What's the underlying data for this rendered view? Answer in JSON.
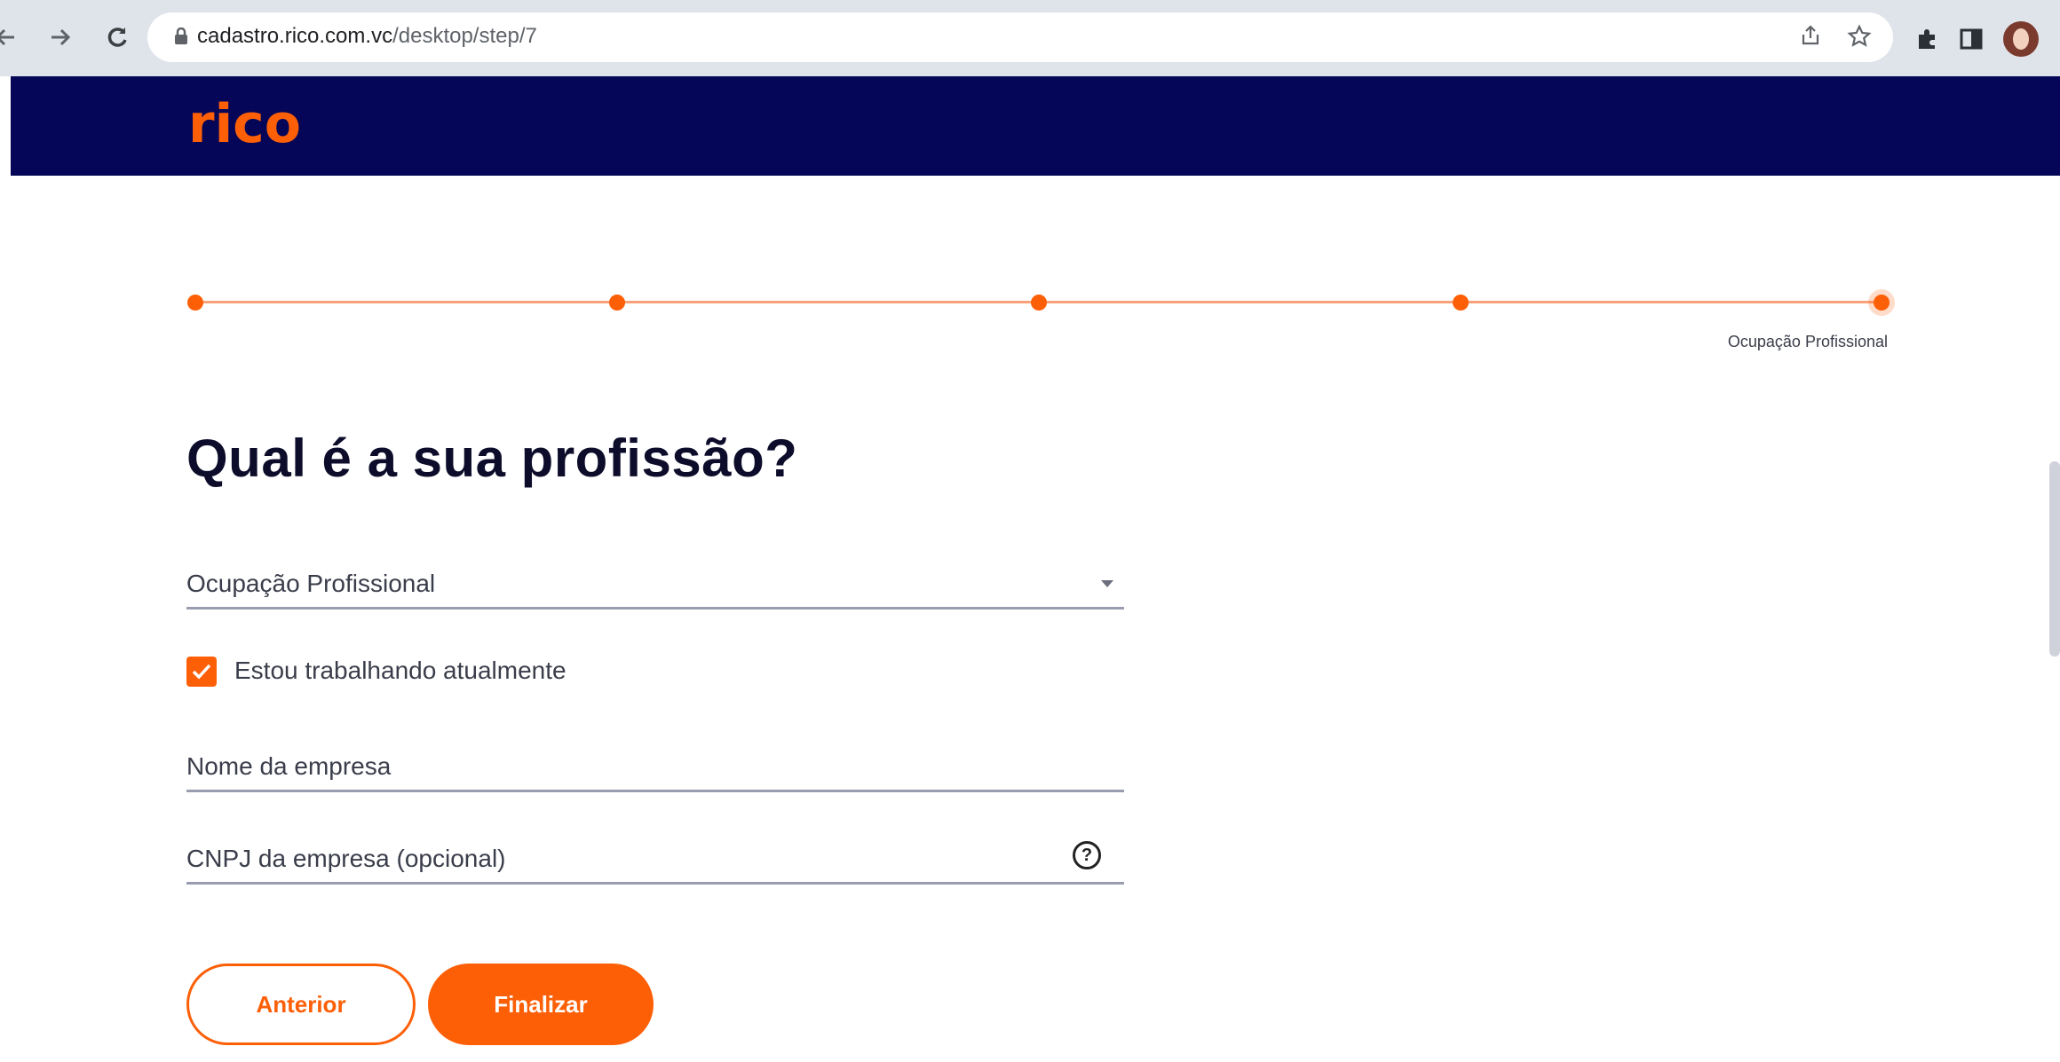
{
  "browser": {
    "url_host": "cadastro.rico.com.vc",
    "url_path": "/desktop/step/7",
    "icons": [
      "back-arrow-icon",
      "forward-arrow-icon",
      "reload-icon",
      "lock-icon",
      "share-icon",
      "bookmark-star-icon",
      "extensions-puzzle-icon",
      "side-panel-icon",
      "profile-avatar-icon"
    ]
  },
  "header": {
    "logo_text": "rico",
    "background_color": "#050657",
    "logo_color": "#fd5f07"
  },
  "progress": {
    "steps_total": 5,
    "current_step": 5,
    "current_label": "Ocupação Profissional",
    "accent_color": "#fd5f07"
  },
  "form": {
    "title": "Qual é a sua profissão?",
    "occupation_label": "Ocupação Profissional",
    "working_checkbox_label": "Estou trabalhando atualmente",
    "working_checked": true,
    "company_name_label": "Nome da empresa",
    "company_cnpj_label": "CNPJ da empresa (opcional)",
    "help_symbol": "?"
  },
  "buttons": {
    "previous_label": "Anterior",
    "finish_label": "Finalizar"
  }
}
